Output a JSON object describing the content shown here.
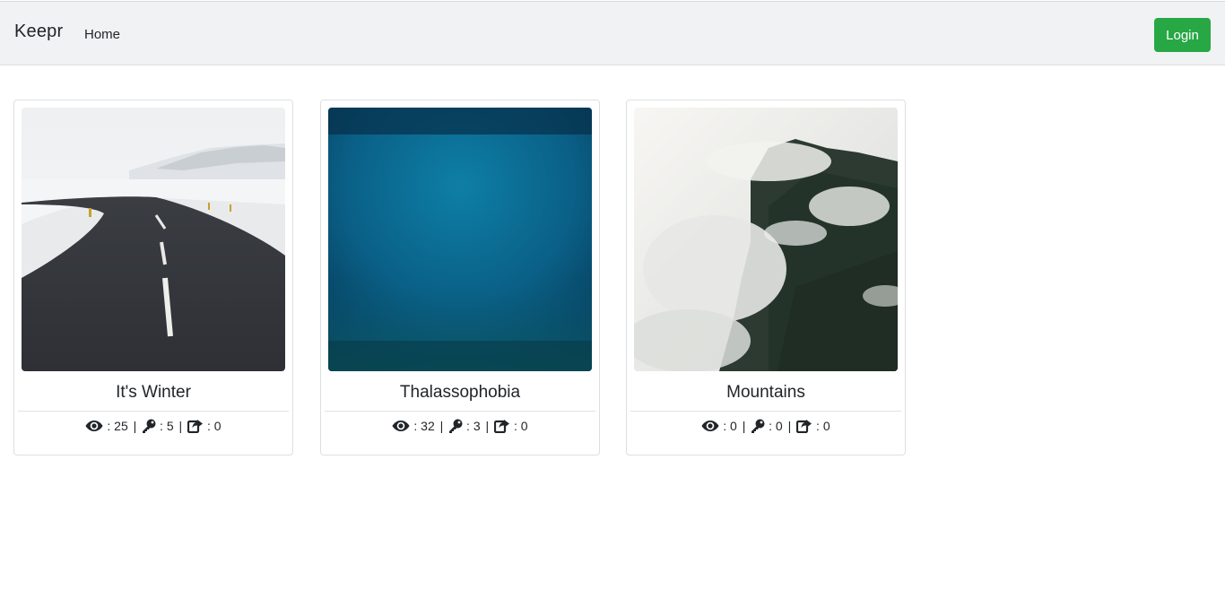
{
  "navbar": {
    "brand": "Keepr",
    "links": [
      {
        "label": "Home"
      }
    ],
    "login_label": "Login",
    "login_color": "#28a745"
  },
  "cards": [
    {
      "title": "It's Winter",
      "image": "snowy-road-photo",
      "stats": {
        "views": ": 25",
        "keeps": ": 5",
        "shares": ": 0"
      }
    },
    {
      "title": "Thalassophobia",
      "image": "deep-ocean-photo",
      "stats": {
        "views": ": 32",
        "keeps": ": 3",
        "shares": ": 0"
      }
    },
    {
      "title": "Mountains",
      "image": "misty-mountain-photo",
      "stats": {
        "views": ": 0",
        "keeps": ": 0",
        "shares": ": 0"
      }
    }
  ],
  "icons": {
    "views": "eye-icon",
    "keeps": "key-icon",
    "shares": "share-icon"
  },
  "separator": "|"
}
